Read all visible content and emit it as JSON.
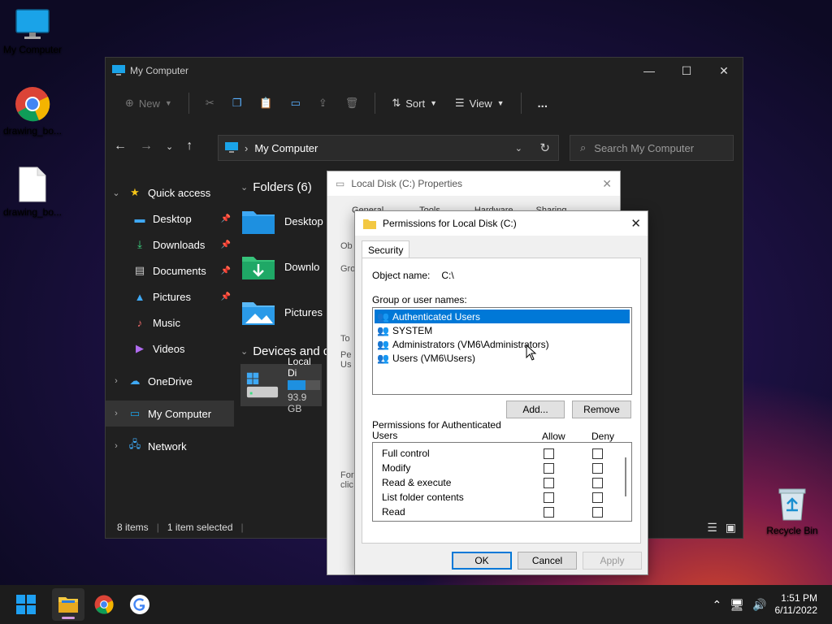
{
  "desktop": {
    "icons": [
      {
        "label": "My Computer",
        "icon": "monitor-icon"
      },
      {
        "label": "drawing_bo...",
        "icon": "chrome-icon"
      },
      {
        "label": "drawing_bo...",
        "icon": "file-icon"
      },
      {
        "label": "Recycle Bin",
        "icon": "recycle-bin-icon"
      }
    ]
  },
  "explorer": {
    "title": "My Computer",
    "toolbar": {
      "new": "New",
      "sort": "Sort",
      "view": "View",
      "more": "..."
    },
    "address": "My Computer",
    "search_placeholder": "Search My Computer",
    "sidebar": {
      "quick_access": "Quick access",
      "items": [
        {
          "label": "Desktop",
          "pinned": true
        },
        {
          "label": "Downloads",
          "pinned": true
        },
        {
          "label": "Documents",
          "pinned": true
        },
        {
          "label": "Pictures",
          "pinned": true
        },
        {
          "label": "Music",
          "pinned": false
        },
        {
          "label": "Videos",
          "pinned": false
        }
      ],
      "onedrive": "OneDrive",
      "my_computer": "My Computer",
      "network": "Network"
    },
    "content": {
      "folders_header": "Folders (6)",
      "folders": [
        "Desktop",
        "Downlo",
        "Pictures"
      ],
      "devices_header": "Devices and d",
      "drive_name": "Local Di",
      "drive_free": "93.9 GB",
      "drive_usage": 0.55
    },
    "status": {
      "items": "8 items",
      "selected": "1 item selected"
    }
  },
  "properties": {
    "title": "Local Disk (C:) Properties",
    "tabs": [
      "General",
      "Tools",
      "Hardware",
      "Sharing"
    ],
    "fragments": [
      "Ob",
      "Gro",
      "To",
      "Pe",
      "Us",
      "For",
      "clic"
    ]
  },
  "permissions": {
    "title": "Permissions for Local Disk (C:)",
    "tab": "Security",
    "object_label": "Object name:",
    "object_value": "C:\\",
    "group_label": "Group or user names:",
    "users": [
      {
        "name": "Authenticated Users",
        "selected": true
      },
      {
        "name": "SYSTEM",
        "selected": false
      },
      {
        "name": "Administrators (VM6\\Administrators)",
        "selected": false
      },
      {
        "name": "Users (VM6\\Users)",
        "selected": false
      }
    ],
    "add_button": "Add...",
    "remove_button": "Remove",
    "perm_label_1": "Permissions for Authenticated",
    "perm_label_2": "Users",
    "allow_header": "Allow",
    "deny_header": "Deny",
    "perms": [
      "Full control",
      "Modify",
      "Read & execute",
      "List folder contents",
      "Read"
    ],
    "ok": "OK",
    "cancel": "Cancel",
    "apply": "Apply"
  },
  "taskbar": {
    "time": "1:51 PM",
    "date": "6/11/2022"
  },
  "colors": {
    "accent": "#0078d7",
    "taskbar": "#1c1c1c",
    "explorer_bg": "#202020"
  }
}
